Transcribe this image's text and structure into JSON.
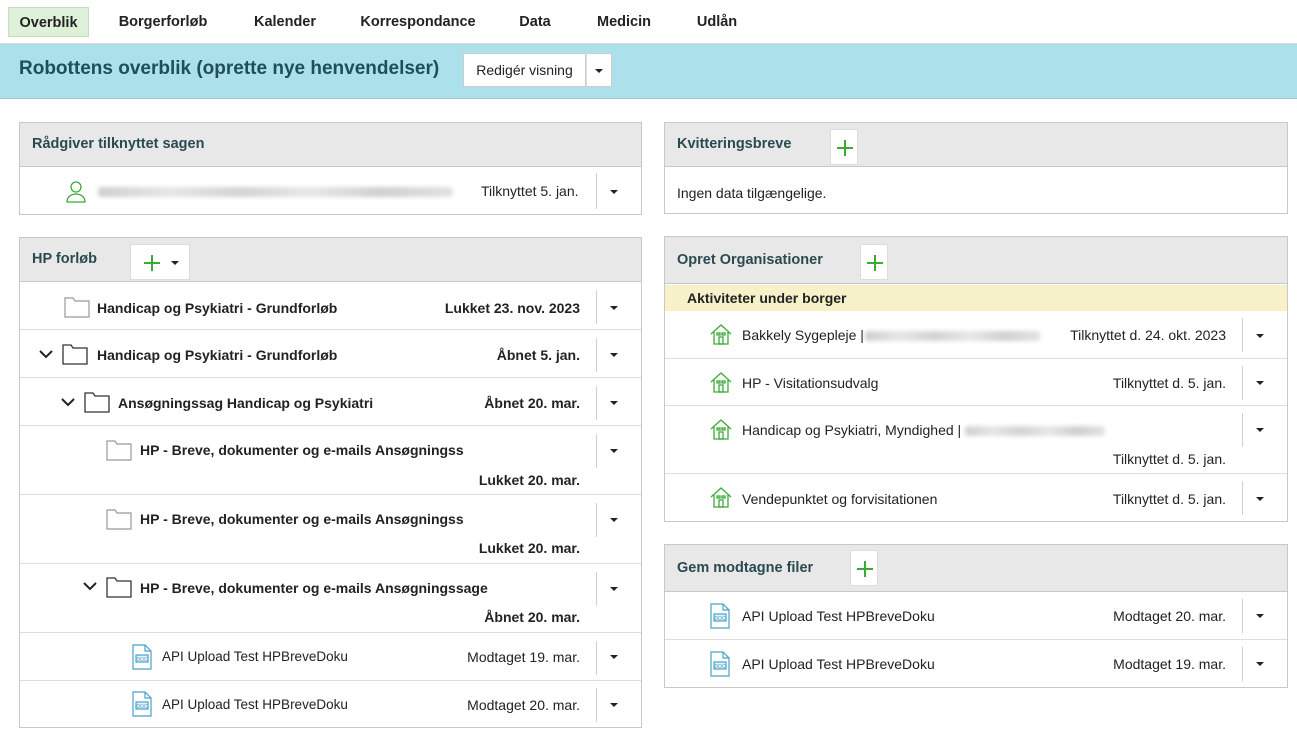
{
  "nav": {
    "tabs": [
      "Overblik",
      "Borgerforløb",
      "Kalender",
      "Korrespondance",
      "Data",
      "Medicin",
      "Udlån"
    ],
    "active": "Overblik"
  },
  "header": {
    "title": "Robottens overblik (oprette nye henvendelser)",
    "edit_label": "Redigér visning"
  },
  "advisor": {
    "title": "Rådgiver tilknyttet sagen",
    "status": "Tilknyttet 5. jan."
  },
  "hp": {
    "title": "HP forløb",
    "rows": [
      {
        "label": "Handicap og Psykiatri - Grundforløb",
        "status": "Lukket 23. nov. 2023"
      },
      {
        "label": "Handicap og Psykiatri - Grundforløb",
        "status": "Åbnet 5. jan."
      },
      {
        "label": "Ansøgningssag Handicap og Psykiatri",
        "status": "Åbnet 20. mar."
      },
      {
        "label": "HP - Breve, dokumenter og e-mails Ansøgningss",
        "status": "Lukket 20. mar."
      },
      {
        "label": "HP - Breve, dokumenter og e-mails Ansøgningss",
        "status": "Lukket 20. mar."
      },
      {
        "label": "HP - Breve, dokumenter og e-mails Ansøgningssage",
        "status": "Åbnet 20. mar."
      },
      {
        "label": "API Upload Test HPBreveDoku",
        "status": "Modtaget 19. mar."
      },
      {
        "label": "API Upload Test HPBreveDoku",
        "status": "Modtaget 20. mar."
      }
    ]
  },
  "receipts": {
    "title": "Kvitteringsbreve",
    "empty": "Ingen data tilgængelige."
  },
  "orgs": {
    "title": "Opret Organisationer",
    "group": "Aktiviteter under borger",
    "rows": [
      {
        "label": "Bakkely Sygepleje |",
        "status": "Tilknyttet d. 24. okt. 2023"
      },
      {
        "label": "HP - Visitationsudvalg",
        "status": "Tilknyttet d. 5. jan."
      },
      {
        "label": "Handicap og Psykiatri, Myndighed |",
        "status": "Tilknyttet d. 5. jan."
      },
      {
        "label": "Vendepunktet og forvisitationen",
        "status": "Tilknyttet d. 5. jan."
      }
    ]
  },
  "files": {
    "title": "Gem modtagne filer",
    "rows": [
      {
        "label": "API Upload Test HPBreveDoku",
        "status": "Modtaget 20. mar."
      },
      {
        "label": "API Upload Test HPBreveDoku",
        "status": "Modtaget 19. mar."
      }
    ]
  },
  "colors": {
    "accent_green": "#3aaa35",
    "header_band": "#ace0ea",
    "active_tab": "#dff0d8",
    "group_band": "#f7f1ca"
  }
}
